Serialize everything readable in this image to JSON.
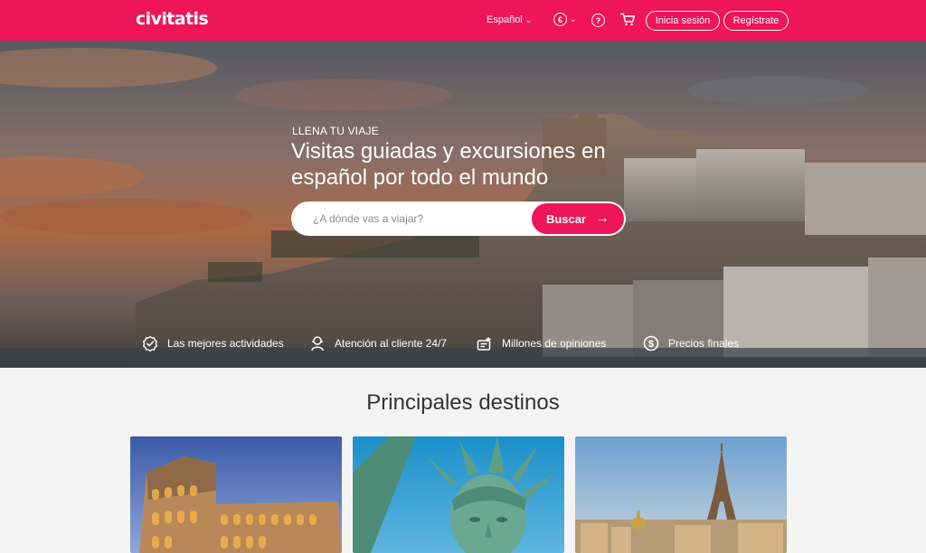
{
  "header": {
    "logo": "civitatis",
    "language": "Español",
    "currency_symbol": "€",
    "help_icon": "help-icon",
    "cart_icon": "cart-icon",
    "login_label": "Inicia sesión",
    "register_label": "Regístrate"
  },
  "hero": {
    "kicker": "LLENA TU VIAJE",
    "headline": "Visitas guiadas y excursiones en español por todo el mundo",
    "search_placeholder": "¿A dónde vas a viajar?",
    "search_button": "Buscar"
  },
  "features": [
    {
      "label": "Las mejores actividades",
      "icon": "badge-check-icon"
    },
    {
      "label": "Atención al cliente 24/7",
      "icon": "support-icon"
    },
    {
      "label": "Millones de opiniones",
      "icon": "reviews-icon"
    },
    {
      "label": "Precios finales",
      "icon": "dollar-icon"
    }
  ],
  "destinations": {
    "title": "Principales destinos",
    "cards": [
      {
        "image": "colosseum-rome"
      },
      {
        "image": "statue-of-liberty-new-york"
      },
      {
        "image": "eiffel-tower-paris"
      }
    ]
  },
  "colors": {
    "brand": "#ee1559",
    "background": "#f4f4f4"
  }
}
